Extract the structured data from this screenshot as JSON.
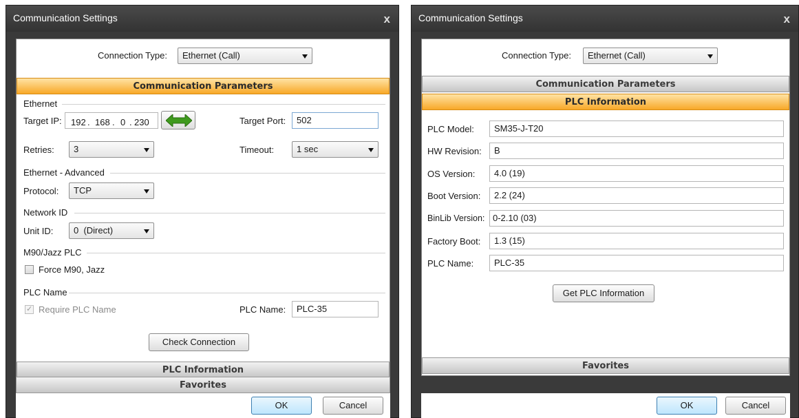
{
  "left_dialog": {
    "title": "Communication Settings",
    "close": "x",
    "connection_type_label": "Connection Type:",
    "connection_type_value": "Ethernet (Call)",
    "sections": {
      "comm_params": "Communication Parameters",
      "plc_info": "PLC Information",
      "favorites": "Favorites"
    },
    "ethernet": {
      "title": "Ethernet",
      "target_ip_label": "Target IP:",
      "ip": [
        "192",
        ".",
        "168",
        ".",
        "0",
        ".",
        "230"
      ],
      "target_port_label": "Target Port:",
      "target_port_value": "502",
      "retries_label": "Retries:",
      "retries_value": "3",
      "timeout_label": "Timeout:",
      "timeout_value": "1 sec"
    },
    "advanced": {
      "title": "Ethernet - Advanced",
      "protocol_label": "Protocol:",
      "protocol_value": "TCP"
    },
    "network": {
      "title": "Network ID",
      "unit_id_label": "Unit ID:",
      "unit_id_value": "0  (Direct)"
    },
    "m90": {
      "title": "M90/Jazz PLC",
      "force_label": "Force M90, Jazz",
      "force_checked": false
    },
    "plc_name": {
      "title": "PLC Name",
      "require_label": "Require PLC Name",
      "require_checked": true,
      "name_label": "PLC Name:",
      "name_value": "PLC-35"
    },
    "check_connection": "Check Connection",
    "ok": "OK",
    "cancel": "Cancel"
  },
  "right_dialog": {
    "title": "Communication Settings",
    "close": "x",
    "connection_type_label": "Connection Type:",
    "connection_type_value": "Ethernet (Call)",
    "sections": {
      "comm_params": "Communication Parameters",
      "plc_info": "PLC Information",
      "favorites": "Favorites"
    },
    "info_rows": [
      {
        "label": "PLC Model:",
        "value": "SM35-J-T20"
      },
      {
        "label": "HW Revision:",
        "value": "B"
      },
      {
        "label": "OS Version:",
        "value": "4.0 (19)"
      },
      {
        "label": "Boot Version:",
        "value": "2.2 (24)"
      },
      {
        "label": "BinLib Version:",
        "value": "0-2.10 (03)"
      },
      {
        "label": "Factory Boot:",
        "value": "1.3 (15)"
      },
      {
        "label": "PLC Name:",
        "value": "PLC-35"
      }
    ],
    "get_info_button": "Get PLC Information",
    "ok": "OK",
    "cancel": "Cancel"
  },
  "colors": {
    "section_active": "#f8a828",
    "section_inactive": "#c6c6c6",
    "titlebar": "#333333",
    "arrow_icon": "#3f9a1e"
  },
  "icons": {
    "connect_arrow": "double-arrow-icon"
  }
}
